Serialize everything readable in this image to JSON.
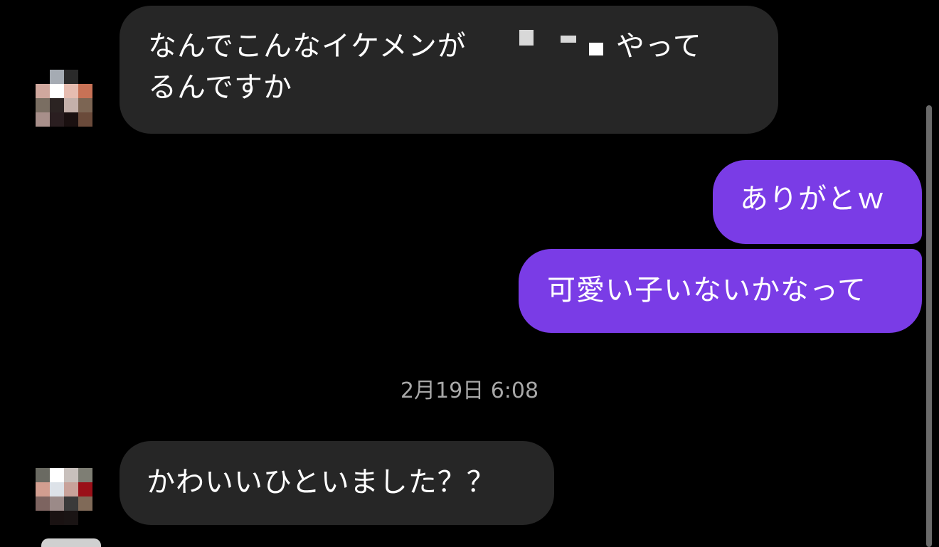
{
  "messages": [
    {
      "direction": "incoming",
      "line1_prefix": "なんでこんなイケメンが",
      "line1_suffix": "やって",
      "line2": "るんですか"
    },
    {
      "direction": "outgoing",
      "text": "ありがとｗ"
    },
    {
      "direction": "outgoing",
      "text": "可愛い子いないかなって"
    },
    {
      "direction": "incoming",
      "text": "かわいいひといました？？"
    }
  ],
  "timestamp": "2月19日 6:08",
  "avatars": {
    "avatar1": [
      "#000000",
      "#a5abb3",
      "#2a2a2a",
      "#000000",
      "#d0a89e",
      "#ffffff",
      "#e6bcb0",
      "#c87256",
      "#7a6e62",
      "#2b2322",
      "#c4b0aa",
      "#7c6553",
      "#a88f8a",
      "#2a1e20",
      "#1a1010",
      "#6a4a3a"
    ],
    "avatar2": [
      "#6a6a62",
      "#ffffff",
      "#c8c0bc",
      "#7e7e74",
      "#d29e90",
      "#dde2e8",
      "#c8a29a",
      "#9a1018",
      "#7d6460",
      "#9b8a88",
      "#3a3a3a",
      "#806a58",
      "#000000",
      "#1a1212",
      "#1a1414",
      "#000000"
    ]
  },
  "colors": {
    "background": "#000000",
    "incoming_bubble": "#262626",
    "outgoing_bubble": "#7a3ce6",
    "timestamp_text": "#a8a8a8"
  }
}
